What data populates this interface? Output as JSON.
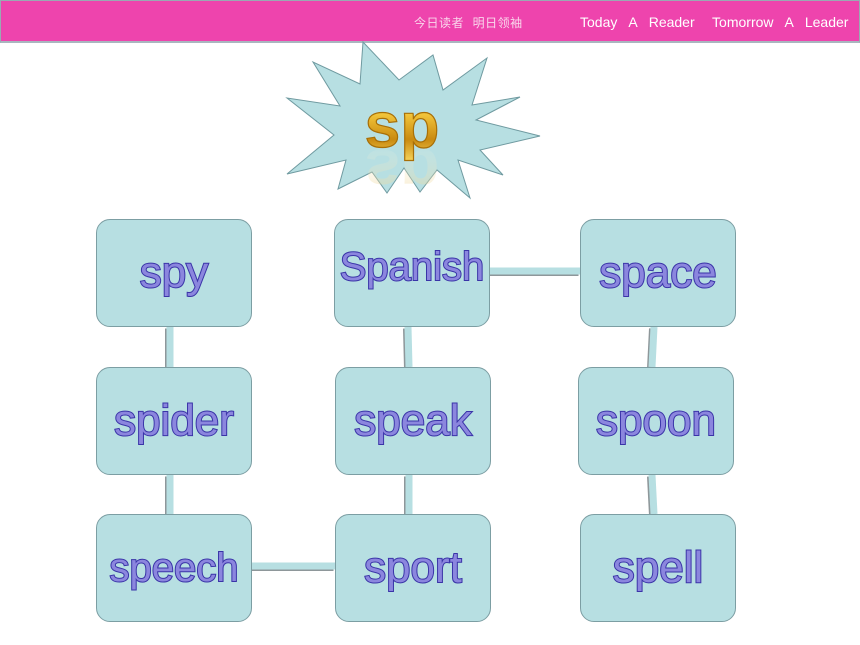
{
  "header": {
    "motto_cn": "今日读者  明日领袖",
    "motto_en": "Today  A  Reader   Tomorrow  A  Leader",
    "bar_color": "#ee44ad"
  },
  "title_badge": {
    "text": "sp",
    "shape": "starburst",
    "fill_color": "#b7dfe2",
    "text_color": "#d9a21c"
  },
  "words": [
    {
      "id": "spy",
      "text": "spy"
    },
    {
      "id": "spanish",
      "text": "Spanish"
    },
    {
      "id": "space",
      "text": "space"
    },
    {
      "id": "spider",
      "text": "spider"
    },
    {
      "id": "speak",
      "text": "speak"
    },
    {
      "id": "spoon",
      "text": "spoon"
    },
    {
      "id": "speech",
      "text": "speech"
    },
    {
      "id": "sport",
      "text": "sport"
    },
    {
      "id": "spell",
      "text": "spell"
    }
  ],
  "connections": [
    [
      "spy",
      "spider"
    ],
    [
      "spider",
      "speech"
    ],
    [
      "speech",
      "sport"
    ],
    [
      "sport",
      "speak"
    ],
    [
      "speak",
      "spanish"
    ],
    [
      "spanish",
      "space"
    ],
    [
      "space",
      "spoon"
    ],
    [
      "spoon",
      "spell"
    ]
  ],
  "colors": {
    "box_fill": "#b7dfe2",
    "box_border": "#7c9ea3",
    "word_fill": "#8b86de",
    "word_outline": "#3a34a8"
  }
}
